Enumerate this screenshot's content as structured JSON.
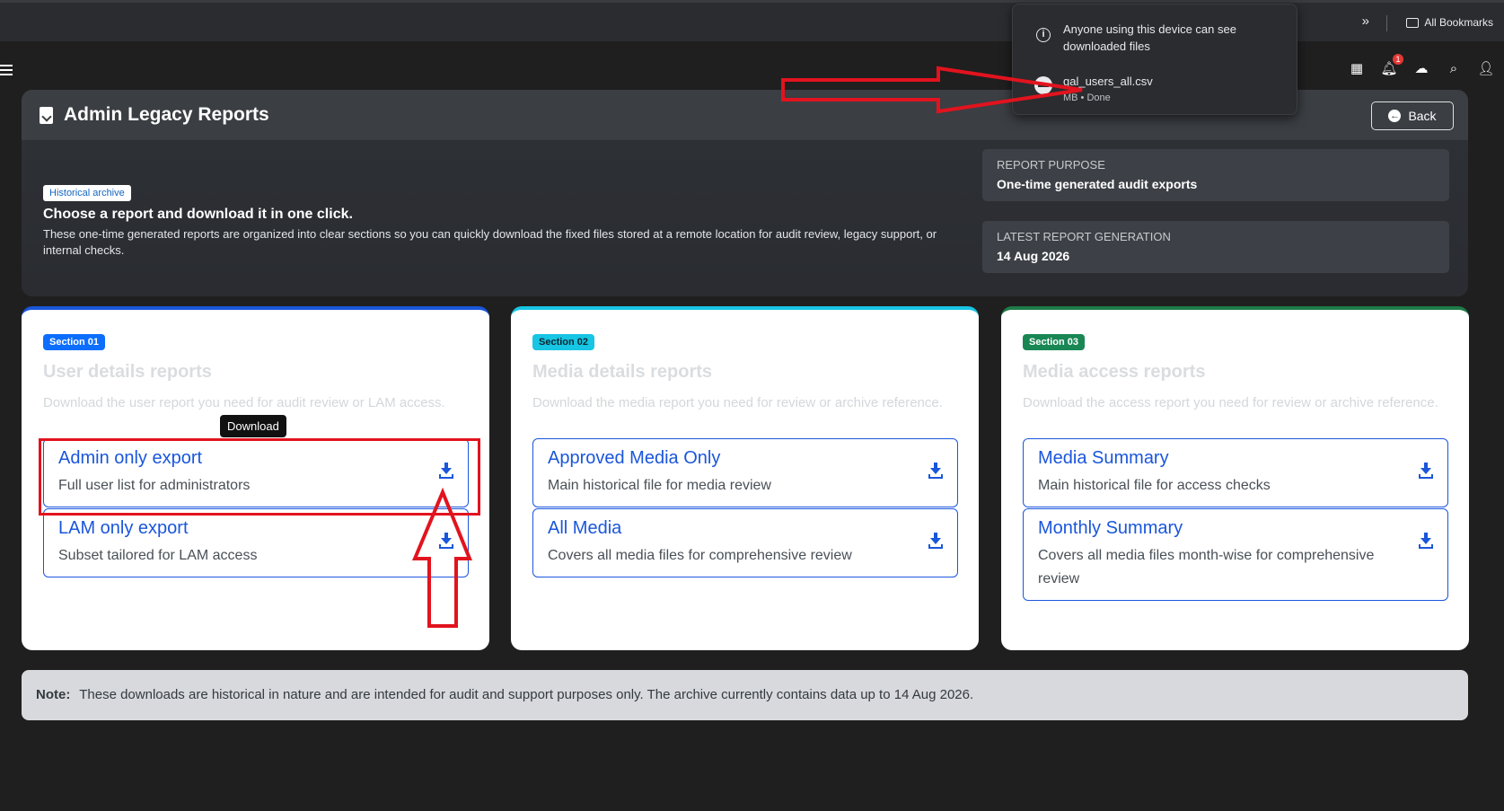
{
  "browser": {
    "bookmarks_label": "All Bookmarks",
    "overflow_glyph": "»"
  },
  "download_popup": {
    "info_text_line1": "Anyone using this device can see",
    "info_text_line2": "downloaded files",
    "file_name": "gal_users_all.csv",
    "file_meta": "MB • Done"
  },
  "navbar": {
    "notification_count": "1"
  },
  "page": {
    "title": "Admin Legacy Reports",
    "back_label": "Back",
    "badge": "Historical archive",
    "headline": "Choose a report and download it in one click.",
    "description": "These one-time generated reports are organized into clear sections so you can quickly download the fixed files stored at a remote location for audit review, legacy support, or internal checks.",
    "purpose_label": "REPORT PURPOSE",
    "purpose_value": "One-time generated audit exports",
    "latest_label": "LATEST REPORT GENERATION",
    "latest_value": "14 Aug 2026"
  },
  "sections": [
    {
      "badge": "Section 01",
      "title": "User details reports",
      "description": "Download the user report you need for audit review or LAM access.",
      "items": [
        {
          "title": "Admin only export",
          "subtitle": "Full user list for administrators"
        },
        {
          "title": "LAM only export",
          "subtitle": "Subset tailored for LAM access"
        }
      ]
    },
    {
      "badge": "Section 02",
      "title": "Media details reports",
      "description": "Download the media report you need for review or archive reference.",
      "items": [
        {
          "title": "Approved Media Only",
          "subtitle": "Main historical file for media review"
        },
        {
          "title": "All Media",
          "subtitle": "Covers all media files for comprehensive review"
        }
      ]
    },
    {
      "badge": "Section 03",
      "title": "Media access reports",
      "description": "Download the access report you need for review or archive reference.",
      "items": [
        {
          "title": "Media Summary",
          "subtitle": "Main historical file for access checks"
        },
        {
          "title": "Monthly Summary",
          "subtitle": "Covers all media files month-wise for comprehensive review"
        }
      ]
    }
  ],
  "tooltip": "Download",
  "note": {
    "label": "Note:",
    "text": "These downloads are historical in nature and are intended for audit and support purposes only. The archive currently contains data up to 14 Aug 2026."
  },
  "colors": {
    "accent_blue": "#1a56db",
    "section2_accent": "#17c5e4",
    "section3_accent": "#1e7b48",
    "annotation_red": "#e2131e"
  }
}
